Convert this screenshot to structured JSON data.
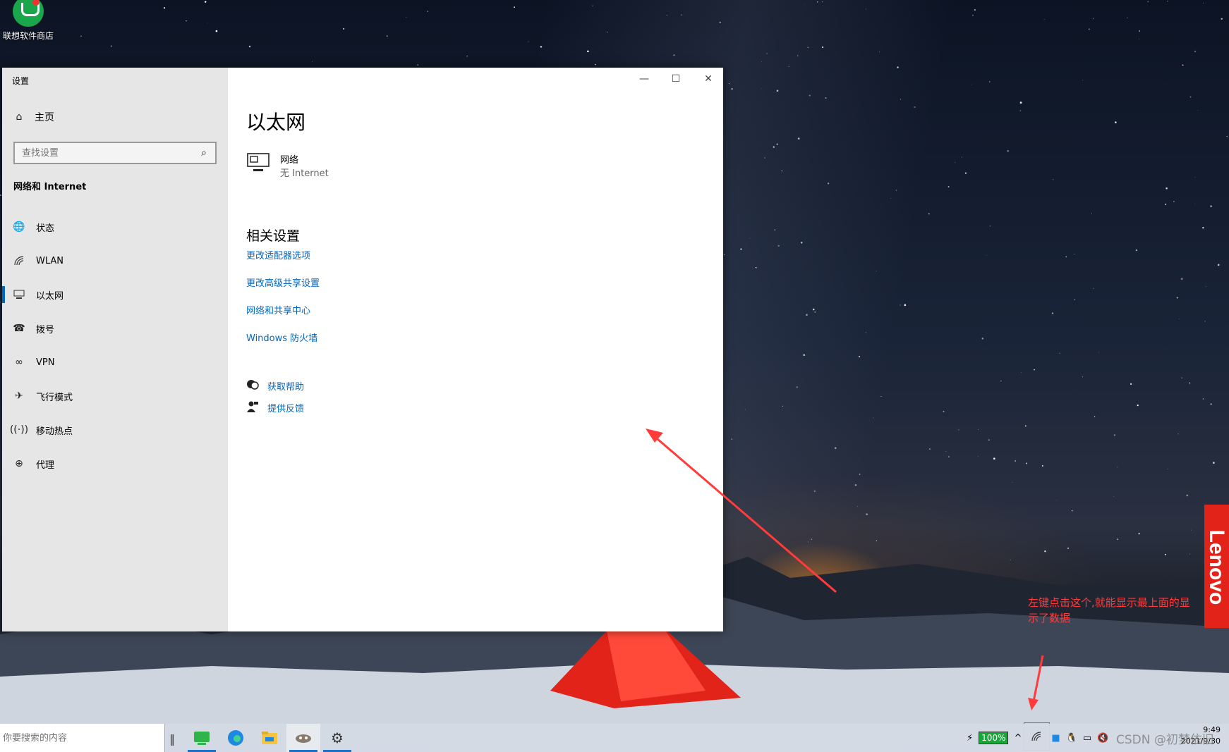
{
  "desktop": {
    "icon_label": "联想软件商店",
    "annotation_text": "左键点击这个,就能显示最上面的显示了数据",
    "brand_tag": "Lenovo",
    "watermark": "CSDN @初梦依旧"
  },
  "window": {
    "title": "设置",
    "controls": {
      "minimize": "—",
      "maximize": "☐",
      "close": "✕"
    }
  },
  "sidebar": {
    "home_label": "主页",
    "search_placeholder": "查找设置",
    "section_title": "网络和 Internet",
    "items": [
      {
        "label": "状态",
        "icon": "globe-status-icon"
      },
      {
        "label": "WLAN",
        "icon": "wifi-icon"
      },
      {
        "label": "以太网",
        "icon": "ethernet-icon",
        "active": true
      },
      {
        "label": "拨号",
        "icon": "dialup-icon"
      },
      {
        "label": "VPN",
        "icon": "vpn-icon"
      },
      {
        "label": "飞行模式",
        "icon": "airplane-icon"
      },
      {
        "label": "移动热点",
        "icon": "hotspot-icon"
      },
      {
        "label": "代理",
        "icon": "globe-icon"
      }
    ]
  },
  "main": {
    "page_title": "以太网",
    "network": {
      "name": "网络",
      "status": "无 Internet"
    },
    "related_title": "相关设置",
    "related_links": [
      "更改适配器选项",
      "更改高级共享设置",
      "网络和共享中心",
      "Windows 防火墙"
    ],
    "help_links": [
      "获取帮助",
      "提供反馈"
    ]
  },
  "taskbar": {
    "search_placeholder": "你要搜索的内容",
    "apps": [
      "green-app-icon",
      "edge-icon",
      "file-explorer-icon",
      "cat-app-icon",
      "settings-icon"
    ],
    "battery": "100%",
    "time": "9:49",
    "date": "2021/9/30"
  },
  "colors": {
    "accent": "#0067c0",
    "annotation": "#ff3b3b",
    "lenovo": "#e2231a"
  }
}
